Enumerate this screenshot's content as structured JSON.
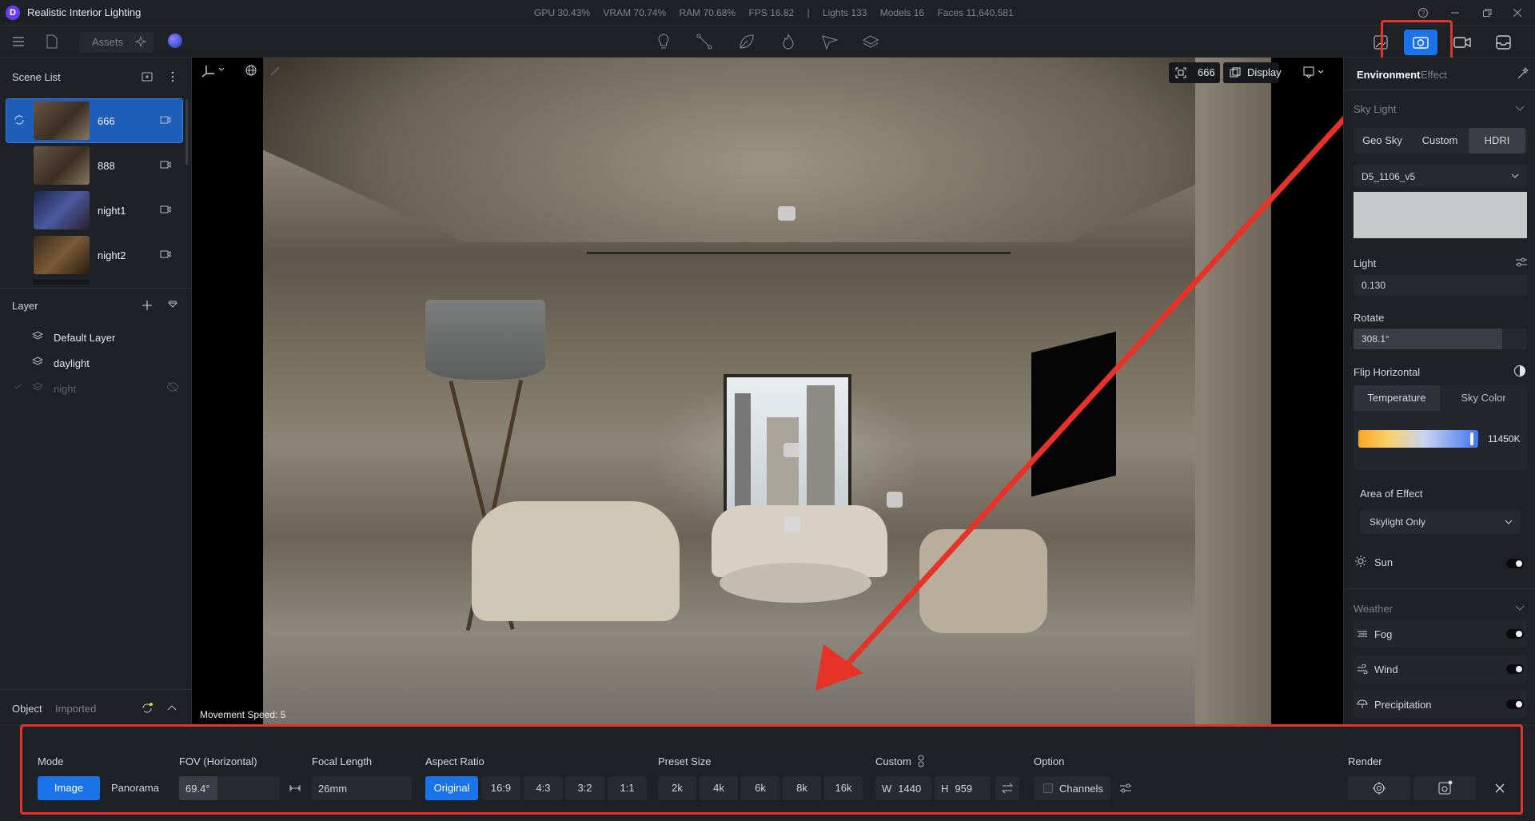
{
  "app": {
    "title": "Realistic Interior Lighting",
    "logo_letter": "D"
  },
  "stats": {
    "gpu": "GPU 30.43%",
    "vram": "VRAM 70.74%",
    "ram": "RAM 70.68%",
    "fps": "FPS 16.82",
    "sep": "|",
    "lights": "Lights 133",
    "models": "Models 16",
    "faces": "Faces 11,640,581"
  },
  "toolbar": {
    "assets_label": "Assets"
  },
  "scene_list": {
    "title": "Scene List",
    "items": [
      {
        "name": "666",
        "active": true
      },
      {
        "name": "888",
        "active": false
      },
      {
        "name": "night1",
        "active": false
      },
      {
        "name": "night2",
        "active": false
      }
    ]
  },
  "layers": {
    "title": "Layer",
    "items": [
      {
        "name": "Default Layer",
        "visible": true
      },
      {
        "name": "daylight",
        "visible": true
      },
      {
        "name": "night",
        "visible": false
      }
    ]
  },
  "left_tabs": {
    "object": "Object",
    "imported": "Imported"
  },
  "viewport": {
    "movement_speed": "Movement Speed: 5",
    "camera_name": "666",
    "display_label": "Display"
  },
  "right_panel": {
    "tabs": {
      "environment": "Environment",
      "effect": "Effect"
    },
    "sky_light": {
      "title": "Sky Light",
      "modes": [
        "Geo Sky",
        "Custom",
        "HDRI"
      ],
      "selected_mode": "HDRI",
      "hdri_name": "D5_1106_v5",
      "light_label": "Light",
      "light_value": "0.130",
      "rotate_label": "Rotate",
      "rotate_value": "308.1°",
      "rotate_fraction": 0.856,
      "flip_label": "Flip Horizontal",
      "color_tabs": [
        "Temperature",
        "Sky Color"
      ],
      "temperature_value": "11450K",
      "area_label": "Area of Effect",
      "area_value": "Skylight Only",
      "sun_label": "Sun"
    },
    "weather": {
      "title": "Weather",
      "items": [
        "Fog",
        "Wind",
        "Precipitation"
      ]
    }
  },
  "bottom_bar": {
    "mode": {
      "label": "Mode",
      "options": [
        "Image",
        "Panorama"
      ],
      "selected": "Image"
    },
    "fov": {
      "label": "FOV (Horizontal)",
      "value": "69.4°"
    },
    "focal": {
      "label": "Focal Length",
      "value": "26mm"
    },
    "aspect": {
      "label": "Aspect Ratio",
      "options": [
        "Original",
        "16:9",
        "4:3",
        "3:2",
        "1:1"
      ],
      "selected": "Original"
    },
    "preset": {
      "label": "Preset Size",
      "options": [
        "2k",
        "4k",
        "6k",
        "8k",
        "16k"
      ]
    },
    "custom": {
      "label": "Custom",
      "w_prefix": "W",
      "w_value": "1440",
      "h_prefix": "H",
      "h_value": "959"
    },
    "option": {
      "label": "Option",
      "channels": "Channels"
    },
    "render": {
      "label": "Render"
    }
  },
  "colors": {
    "accent": "#1a73e8",
    "annotation": "#e5332a",
    "panel": "#1e2126"
  }
}
